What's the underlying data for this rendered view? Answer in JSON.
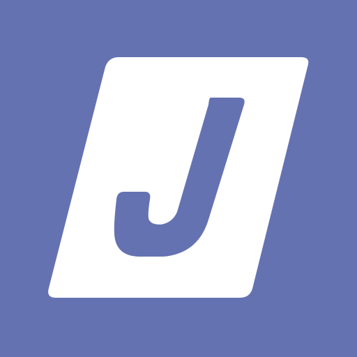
{
  "app_icon": {
    "icon": "j-logo-icon",
    "logo_text": "J",
    "colors": {
      "background": "#6572b2",
      "tile": "#ffffff",
      "letter": "#6572b2"
    }
  }
}
